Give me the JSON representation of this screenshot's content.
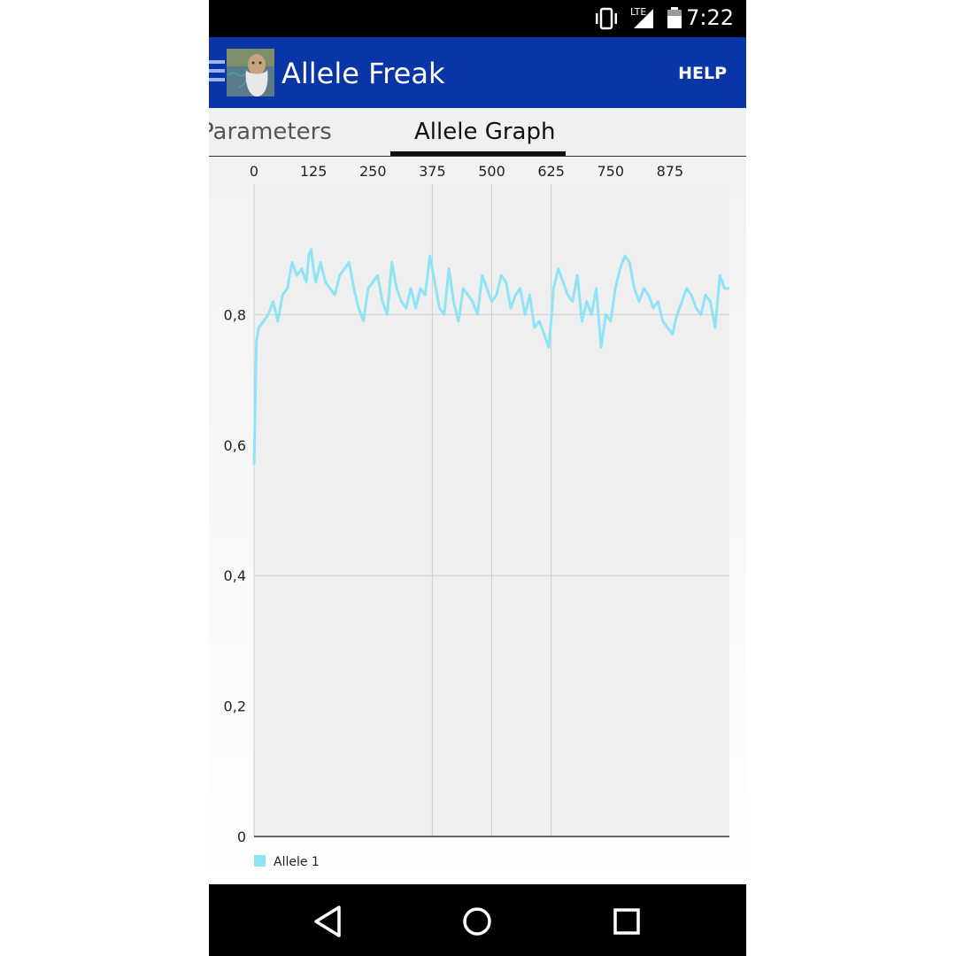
{
  "status_bar": {
    "time": "7:22",
    "network": "LTE",
    "icons": [
      "vibrate-icon",
      "lte-signal-icon",
      "battery-icon"
    ]
  },
  "app_bar": {
    "title": "Allele Freak",
    "help_label": "HELP",
    "color": "#0a35a6"
  },
  "tabs": [
    {
      "label": "Parameters",
      "active": false
    },
    {
      "label": "Allele Graph",
      "active": true
    }
  ],
  "chart_data": {
    "type": "line",
    "xlim": [
      0,
      1000
    ],
    "ylim": [
      0,
      1
    ],
    "x_ticks": [
      "0",
      "125",
      "250",
      "375",
      "500",
      "625",
      "750",
      "875"
    ],
    "y_ticks": [
      "0",
      "0,2",
      "0,4",
      "0,6",
      "0,8"
    ],
    "x_tick_values": [
      0,
      125,
      250,
      375,
      500,
      625,
      750,
      875
    ],
    "y_tick_values": [
      0,
      0.2,
      0.4,
      0.6,
      0.8
    ],
    "x_axis_position": "top",
    "vertical_gridlines_at": [
      375,
      500,
      625
    ],
    "horizontal_gridlines_at": [
      0.4,
      0.8
    ],
    "legend_position": "bottom-left",
    "series": [
      {
        "name": "Allele 1",
        "color": "#8fe3f7",
        "x": [
          0,
          5,
          10,
          20,
          30,
          40,
          50,
          60,
          70,
          80,
          90,
          100,
          110,
          115,
          120,
          125,
          130,
          140,
          150,
          160,
          170,
          180,
          190,
          200,
          210,
          220,
          230,
          240,
          250,
          260,
          270,
          280,
          290,
          300,
          310,
          320,
          330,
          340,
          350,
          360,
          370,
          375,
          380,
          390,
          400,
          410,
          420,
          430,
          440,
          450,
          460,
          470,
          480,
          490,
          500,
          510,
          520,
          530,
          540,
          550,
          560,
          570,
          580,
          590,
          600,
          610,
          620,
          625,
          630,
          640,
          650,
          660,
          670,
          680,
          690,
          700,
          710,
          720,
          730,
          740,
          750,
          760,
          770,
          780,
          790,
          800,
          810,
          820,
          830,
          840,
          850,
          860,
          870,
          880,
          890,
          900,
          910,
          920,
          930,
          940,
          950,
          960,
          970,
          980,
          990,
          1000
        ],
        "y": [
          0.57,
          0.76,
          0.78,
          0.79,
          0.8,
          0.82,
          0.79,
          0.83,
          0.84,
          0.88,
          0.86,
          0.87,
          0.85,
          0.89,
          0.9,
          0.87,
          0.85,
          0.88,
          0.85,
          0.84,
          0.83,
          0.86,
          0.87,
          0.88,
          0.84,
          0.81,
          0.79,
          0.84,
          0.85,
          0.86,
          0.82,
          0.8,
          0.88,
          0.84,
          0.82,
          0.81,
          0.84,
          0.81,
          0.84,
          0.83,
          0.89,
          0.87,
          0.85,
          0.81,
          0.8,
          0.87,
          0.82,
          0.79,
          0.84,
          0.83,
          0.82,
          0.8,
          0.86,
          0.84,
          0.82,
          0.83,
          0.86,
          0.85,
          0.81,
          0.83,
          0.84,
          0.8,
          0.83,
          0.78,
          0.79,
          0.77,
          0.75,
          0.79,
          0.84,
          0.87,
          0.85,
          0.83,
          0.82,
          0.86,
          0.79,
          0.82,
          0.8,
          0.84,
          0.75,
          0.8,
          0.79,
          0.84,
          0.87,
          0.89,
          0.88,
          0.84,
          0.82,
          0.84,
          0.83,
          0.81,
          0.82,
          0.79,
          0.78,
          0.77,
          0.8,
          0.82,
          0.84,
          0.83,
          0.81,
          0.8,
          0.83,
          0.82,
          0.78,
          0.86,
          0.84,
          0.84
        ]
      }
    ]
  }
}
